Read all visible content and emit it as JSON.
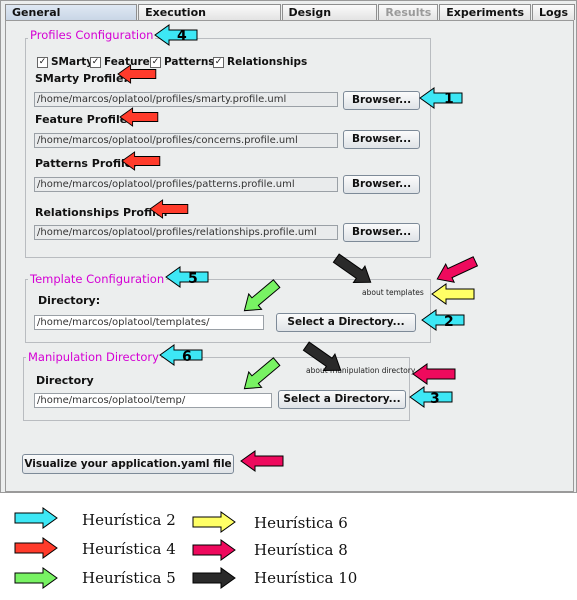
{
  "tabs": [
    {
      "label": "General Configurations"
    },
    {
      "label": "Execution Configurations"
    },
    {
      "label": "Design Patterns"
    },
    {
      "label": "Results"
    },
    {
      "label": "Experiments"
    },
    {
      "label": "Logs"
    }
  ],
  "profiles": {
    "legend": "Profiles Configuration",
    "checkboxes": [
      "SMarty",
      "Feature",
      "Patterns",
      "Relationships"
    ],
    "smarty_label": "SMarty Profile:",
    "smarty_path": "/home/marcos/oplatool/profiles/smarty.profile.uml",
    "feature_label": "Feature Profile:",
    "feature_path": "/home/marcos/oplatool/profiles/concerns.profile.uml",
    "patterns_label": "Patterns Profile:",
    "patterns_path": "/home/marcos/oplatool/profiles/patterns.profile.uml",
    "relationships_label": "Relationships Profile:",
    "relationships_path": "/home/marcos/oplatool/profiles/relationships.profile.uml",
    "browse_label": "Browser..."
  },
  "template": {
    "legend": "Template Configuration",
    "dir_label": "Directory:",
    "path": "/home/marcos/oplatool/templates/",
    "select_label": "Select a Directory...",
    "about": "about templates"
  },
  "manipulation": {
    "legend": "Manipulation Directory",
    "dir_label": "Directory",
    "path": "/home/marcos/oplatool/temp/",
    "select_label": "Select a Directory...",
    "about": "about manipulation directory"
  },
  "visualize_label": "Visualize your application.yaml file",
  "badges": [
    "1",
    "2",
    "3",
    "4",
    "5",
    "6"
  ],
  "legend_items": [
    {
      "label": "Heurística 2",
      "color": "#3de7f5"
    },
    {
      "label": "Heurística 4",
      "color": "#ff3b2b"
    },
    {
      "label": "Heurística 5",
      "color": "#78f263"
    },
    {
      "label": "Heurística 6",
      "color": "#ffff66"
    },
    {
      "label": "Heurística 8",
      "color": "#ee0a5d"
    },
    {
      "label": "Heurística 10",
      "color": "#2a2a2a"
    }
  ]
}
